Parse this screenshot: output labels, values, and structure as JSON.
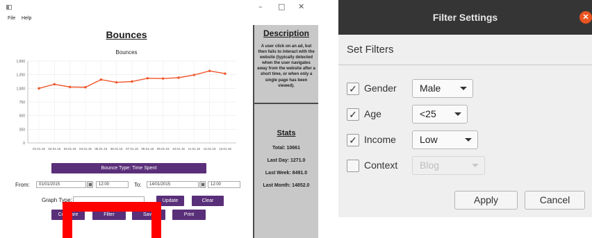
{
  "win1": {
    "menu": [
      "File",
      "Help"
    ],
    "controls": {
      "minimize": "–",
      "maximize": "□",
      "close": "✕"
    },
    "heading": "Bounces",
    "chart_title": "Bounces",
    "description_heading": "Description",
    "description_text": "A user click on an ad, but then fails to interact with the website (typically detected when the user navigates away from the webstie after a short time, or when only a single page has been viewed).",
    "stats_heading": "Stats",
    "stats": [
      "Total: 10661",
      "Last Day: 1271.0",
      "Last Week: 8491.0",
      "Last Month: 14852.0"
    ],
    "bounce_type_button": "Bounce Type: Time Spent",
    "from_label": "From:",
    "from_date": "01/01/2015",
    "from_time": "12:00",
    "to_label": "To:",
    "to_date": "14/01/2015",
    "to_time": "12:00",
    "graph_type_label": "Graph Type:",
    "update_button": "Update",
    "clear_button": "Clear",
    "compare_button": "Compare",
    "filter_button": "Filter",
    "save_button": "Save",
    "print_button": "Print"
  },
  "chart_data": {
    "type": "line",
    "title": "Bounces",
    "xlabel": "",
    "ylabel": "",
    "categories": [
      "01.01.15",
      "02.01.15",
      "03.01.15",
      "04.01.15",
      "05.01.15",
      "06.01.15",
      "07.01.15",
      "08.01.15",
      "09.01.15",
      "10.01.15",
      "11.01.15",
      "12.01.15",
      "13.01.15"
    ],
    "values": [
      1000,
      1075,
      1025,
      1020,
      1160,
      1110,
      1125,
      1185,
      1180,
      1195,
      1245,
      1320,
      1270
    ],
    "ylim": [
      0,
      1500
    ],
    "yticks": [
      0,
      250,
      500,
      750,
      1000,
      1250,
      1500
    ],
    "ytick_labels": [
      "0",
      "250",
      "500",
      "750",
      "1,000",
      "1,250",
      "1,500"
    ],
    "series_color": "#f0562b",
    "grid": true
  },
  "win2": {
    "title": "Filter Settings",
    "close_icon": "close-icon",
    "heading": "Set Filters",
    "filters": [
      {
        "label": "Gender",
        "checked": true,
        "value": "Male"
      },
      {
        "label": "Age",
        "checked": true,
        "value": "<25"
      },
      {
        "label": "Income",
        "checked": true,
        "value": "Low"
      },
      {
        "label": "Context",
        "checked": false,
        "value": "Blog"
      }
    ],
    "apply_button": "Apply",
    "cancel_button": "Cancel"
  },
  "colors": {
    "purple": "#5a2f79",
    "ubuntu_orange": "#e95420",
    "highlight_red": "#ff0000",
    "line": "#f0562b"
  }
}
